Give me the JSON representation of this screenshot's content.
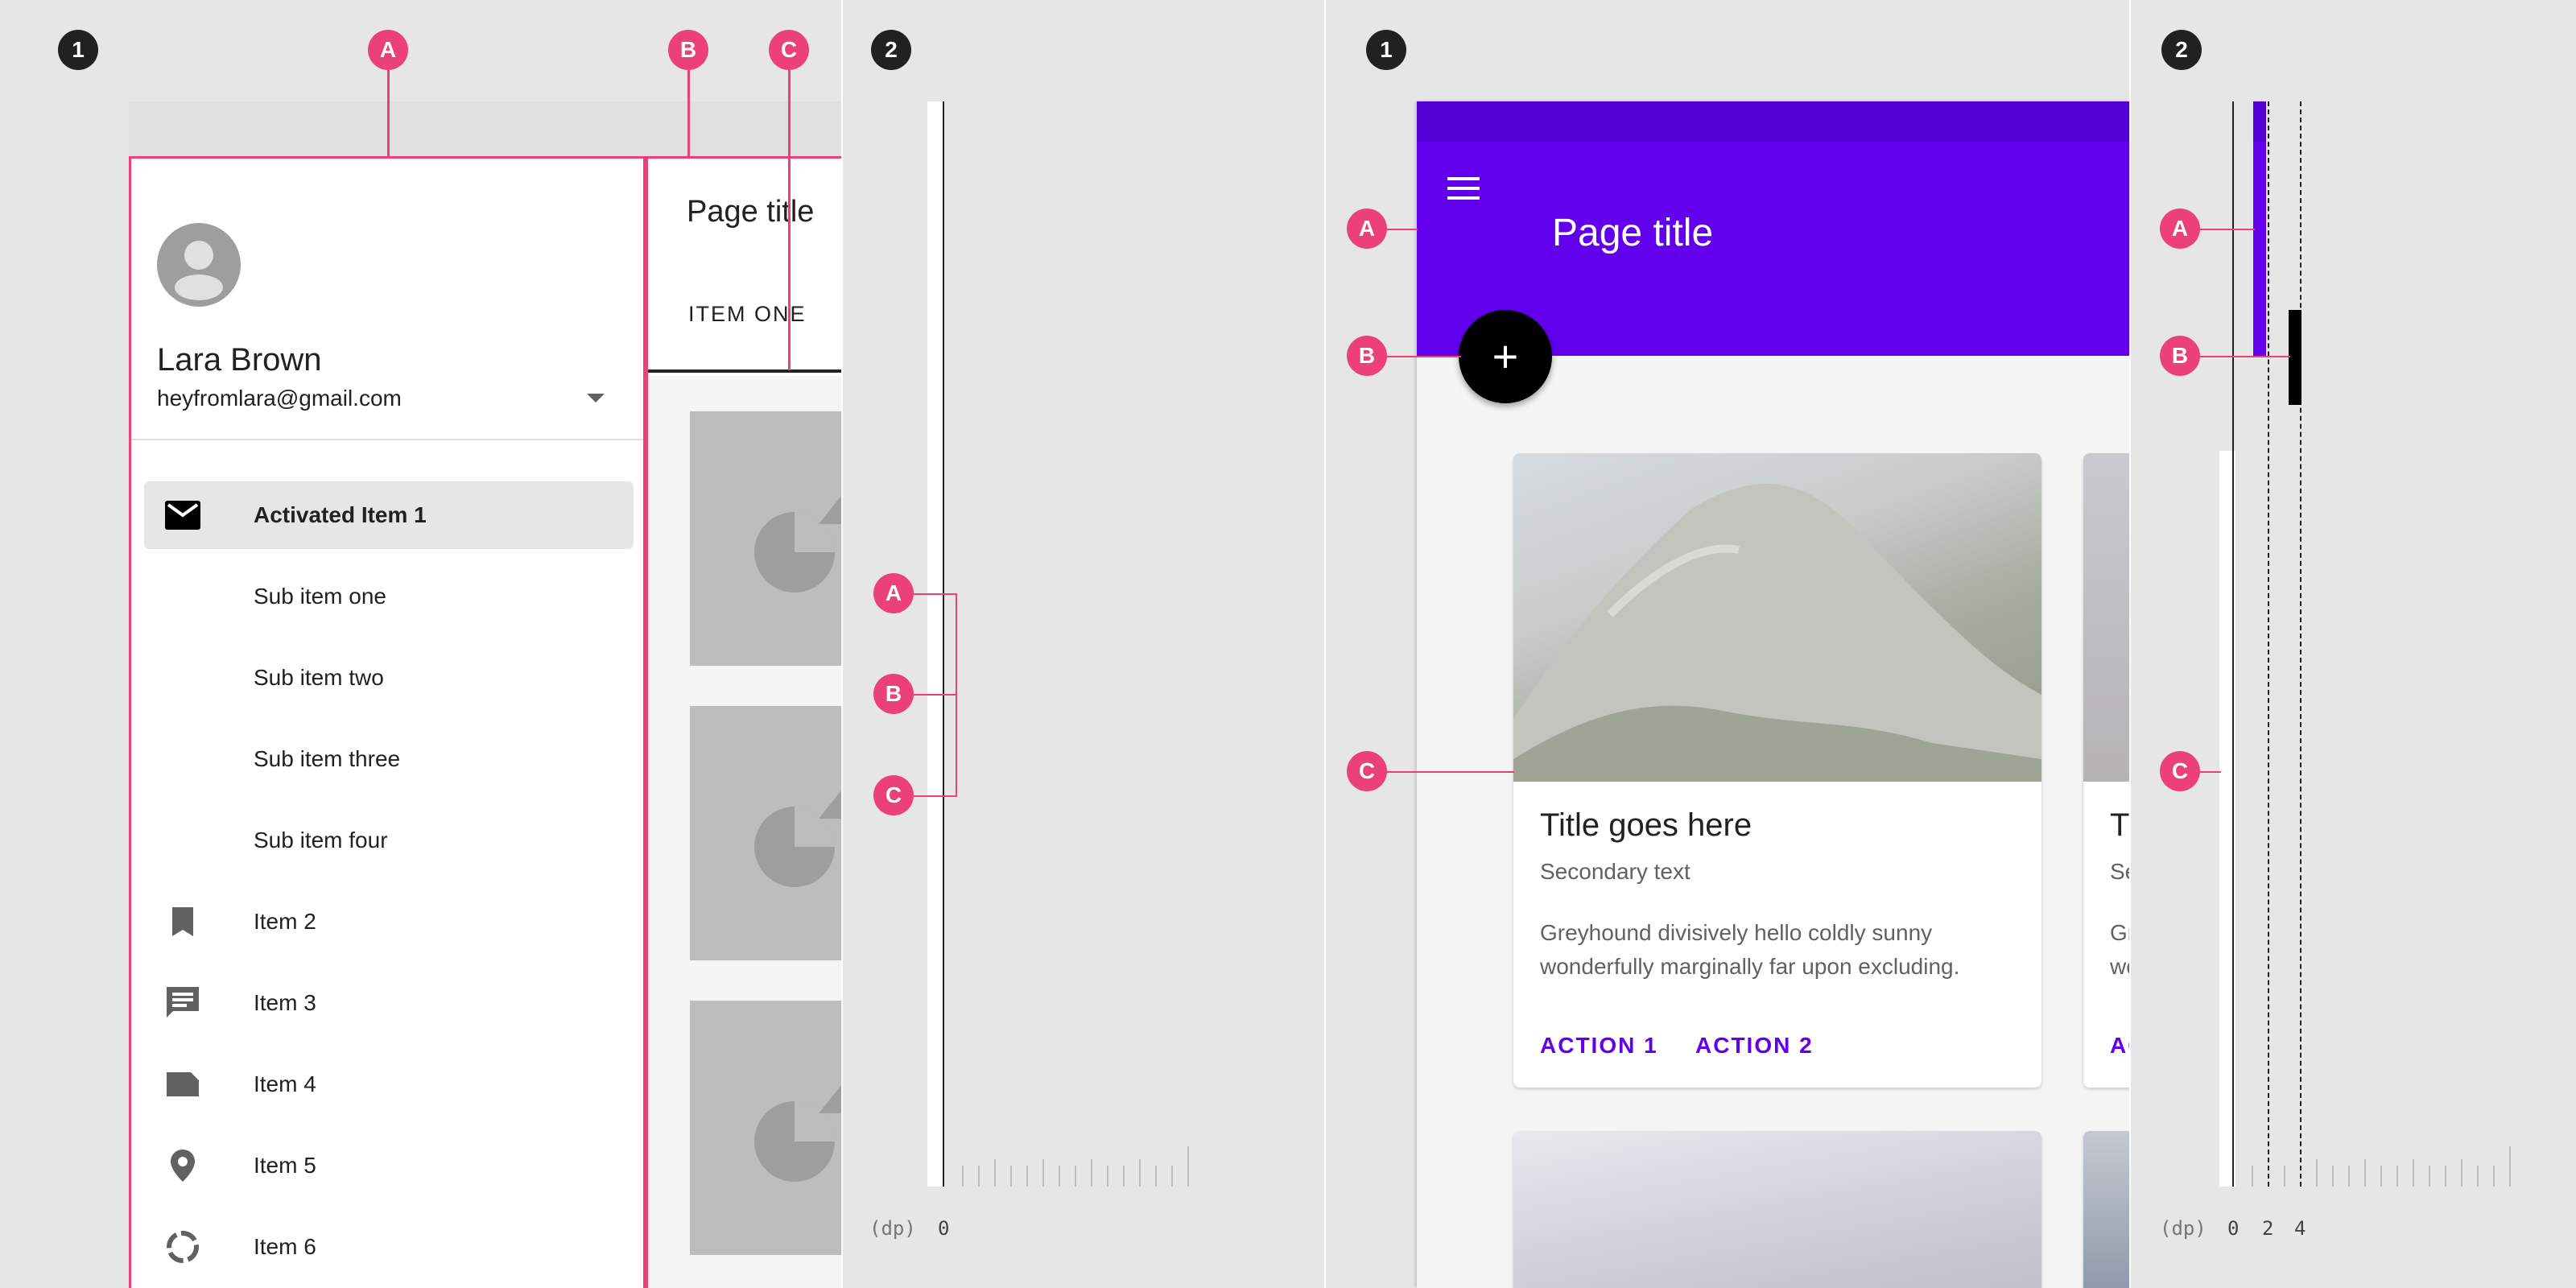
{
  "badges": {
    "step1": "1",
    "step2": "2",
    "a": "A",
    "b": "B",
    "c": "C"
  },
  "drawer": {
    "user_name": "Lara Brown",
    "user_email": "heyfromlara@gmail.com",
    "items": [
      {
        "label": "Activated Item 1",
        "icon": "mail-icon",
        "activated": true
      },
      {
        "label": "Sub item one",
        "icon": ""
      },
      {
        "label": "Sub item two",
        "icon": ""
      },
      {
        "label": "Sub item three",
        "icon": ""
      },
      {
        "label": "Sub item four",
        "icon": ""
      },
      {
        "label": "Item 2",
        "icon": "bookmark-icon"
      },
      {
        "label": "Item 3",
        "icon": "chat-icon"
      },
      {
        "label": "Item 4",
        "icon": "label-icon"
      },
      {
        "label": "Item 5",
        "icon": "location-pin-icon"
      },
      {
        "label": "Item 6",
        "icon": "progress-ring-icon"
      }
    ]
  },
  "content": {
    "page_title": "Page title",
    "tab_label": "ITEM ONE"
  },
  "ruler": {
    "unit": "(dp)",
    "label_0": "0",
    "label_2": "2",
    "label_4": "4"
  },
  "app_bar": {
    "title": "Page title",
    "fab_symbol": "+"
  },
  "card": {
    "title": "Title goes here",
    "secondary": "Secondary text",
    "body_line1": "Greyhound divisively hello coldly sunny",
    "body_line2": "wonderfully marginally far upon excluding.",
    "action1": "ACTION 1",
    "action2": "ACTION 2",
    "peek_title": "T",
    "peek_secondary": "Se",
    "peek_body1": "Gr",
    "peek_body2": "wo",
    "peek_action": "AC"
  },
  "colors": {
    "accent_pink": "#ec407a",
    "primary_purple": "#6200ee",
    "status_purple": "#5300d4",
    "background": "#e6e6e6"
  }
}
